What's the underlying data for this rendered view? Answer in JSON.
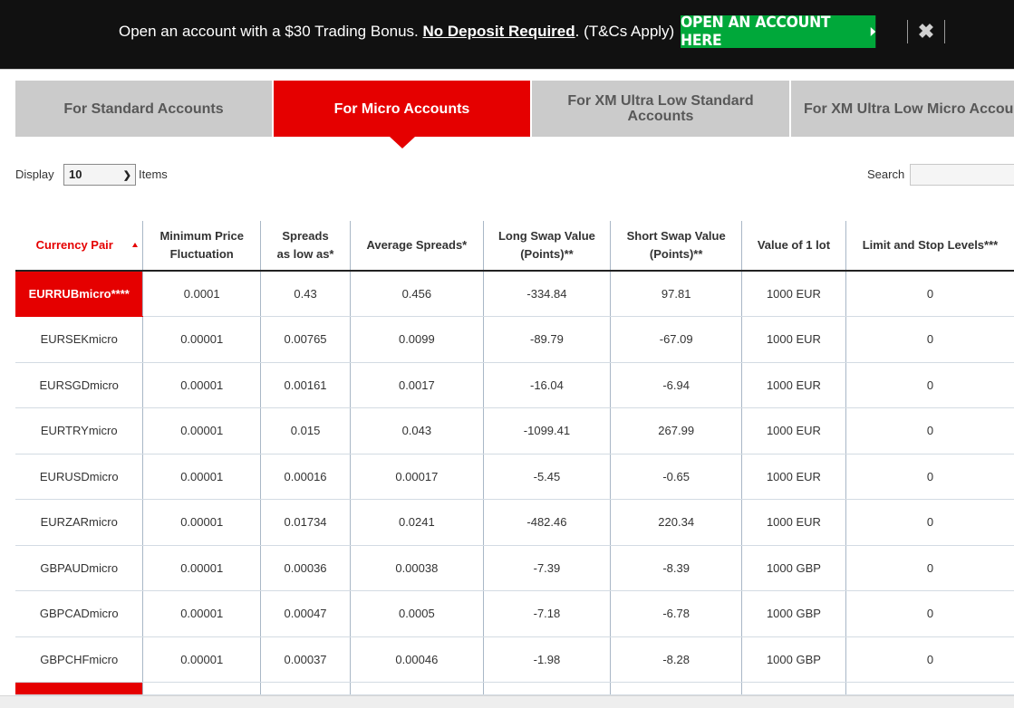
{
  "promo": {
    "text_before": "Open an account with a $30 Trading Bonus. ",
    "text_strong": "No Deposit Required",
    "text_after": ". (T&Cs Apply)",
    "button_label": "OPEN AN ACCOUNT HERE",
    "button_icon": "caret-right-icon",
    "close_icon": "close-icon",
    "button_color": "#00a83a"
  },
  "tabs": [
    {
      "label": "For Standard Accounts",
      "active": false
    },
    {
      "label": "For Micro Accounts",
      "active": true
    },
    {
      "label": "For XM Ultra Low Standard Accounts",
      "active": false
    },
    {
      "label": "For XM Ultra Low Micro Accounts",
      "active": false
    }
  ],
  "accent_color": "#e50000",
  "controls": {
    "display_label": "Display",
    "display_value": "10",
    "items_label": "Items",
    "search_label": "Search",
    "search_value": ""
  },
  "table": {
    "columns": [
      "Currency Pair",
      "Minimum Price Fluctuation",
      "Spreads as low as*",
      "Average Spreads*",
      "Long Swap Value (Points)**",
      "Short Swap Value (Points)**",
      "Value of 1 lot",
      "Limit and Stop Levels***"
    ],
    "column_header_lines": [
      [
        "Currency Pair"
      ],
      [
        "Minimum Price",
        "Fluctuation"
      ],
      [
        "Spreads",
        "as low as*"
      ],
      [
        "Average Spreads*"
      ],
      [
        "Long Swap Value",
        "(Points)**"
      ],
      [
        "Short Swap Value",
        "(Points)**"
      ],
      [
        "Value of 1 lot"
      ],
      [
        "Limit and Stop Levels***"
      ]
    ],
    "sorted_column": "Currency Pair",
    "sort_direction": "ascending",
    "rows": [
      [
        "EURRUBmicro****",
        "0.0001",
        "0.43",
        "0.456",
        "-334.84",
        "97.81",
        "1000 EUR",
        "0"
      ],
      [
        "EURSEKmicro",
        "0.00001",
        "0.00765",
        "0.0099",
        "-89.79",
        "-67.09",
        "1000 EUR",
        "0"
      ],
      [
        "EURSGDmicro",
        "0.00001",
        "0.00161",
        "0.0017",
        "-16.04",
        "-6.94",
        "1000 EUR",
        "0"
      ],
      [
        "EURTRYmicro",
        "0.00001",
        "0.015",
        "0.043",
        "-1099.41",
        "267.99",
        "1000 EUR",
        "0"
      ],
      [
        "EURUSDmicro",
        "0.00001",
        "0.00016",
        "0.00017",
        "-5.45",
        "-0.65",
        "1000 EUR",
        "0"
      ],
      [
        "EURZARmicro",
        "0.00001",
        "0.01734",
        "0.0241",
        "-482.46",
        "220.34",
        "1000 EUR",
        "0"
      ],
      [
        "GBPAUDmicro",
        "0.00001",
        "0.00036",
        "0.00038",
        "-7.39",
        "-8.39",
        "1000 GBP",
        "0"
      ],
      [
        "GBPCADmicro",
        "0.00001",
        "0.00047",
        "0.0005",
        "-7.18",
        "-6.78",
        "1000 GBP",
        "0"
      ],
      [
        "GBPCHFmicro",
        "0.00001",
        "0.00037",
        "0.00046",
        "-1.98",
        "-8.28",
        "1000 GBP",
        "0"
      ]
    ]
  }
}
